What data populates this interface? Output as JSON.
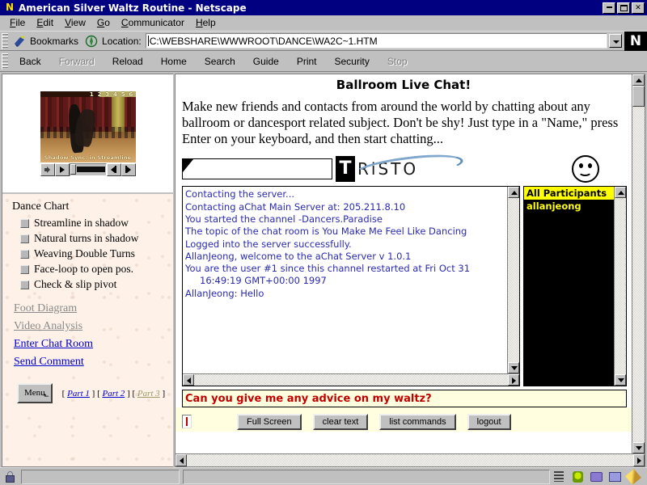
{
  "window": {
    "title": "American Silver Waltz Routine - Netscape",
    "app_icon": "netscape-icon",
    "minimize_label": "Minimize",
    "restore_label": "Restore",
    "close_label": "Close"
  },
  "menubar": {
    "items": [
      {
        "label": "File",
        "accel": "F"
      },
      {
        "label": "Edit",
        "accel": "E"
      },
      {
        "label": "View",
        "accel": "V"
      },
      {
        "label": "Go",
        "accel": "G"
      },
      {
        "label": "Communicator",
        "accel": "C"
      },
      {
        "label": "Help",
        "accel": "H"
      }
    ]
  },
  "location_bar": {
    "bookmarks_label": "Bookmarks",
    "location_label": "Location:",
    "url": "C:\\WEBSHARE\\WWWROOT\\DANCE\\WA2C~1.HTM",
    "placeholder": "Enter URL",
    "dropdown_icon": "chevron-down-icon",
    "bookmark_icon": "bookmark-icon",
    "compass_icon": "compass-icon",
    "brand_letter": "N"
  },
  "navbar": {
    "buttons": [
      {
        "label": "Back",
        "disabled": false
      },
      {
        "label": "Forward",
        "disabled": true
      },
      {
        "label": "Reload",
        "disabled": false
      },
      {
        "label": "Home",
        "disabled": false
      },
      {
        "label": "Search",
        "disabled": false
      },
      {
        "label": "Guide",
        "disabled": false
      },
      {
        "label": "Print",
        "disabled": false
      },
      {
        "label": "Security",
        "disabled": false
      },
      {
        "label": "Stop",
        "disabled": true
      }
    ]
  },
  "sidebar": {
    "video": {
      "counter": "1 2 3 4 5 6",
      "caption": "Shadow Sync. in Streamline",
      "controls": [
        {
          "name": "volume-button",
          "icon": "speaker-icon"
        },
        {
          "name": "play-button",
          "icon": "play-icon"
        },
        {
          "name": "step-back-button",
          "icon": "step-back-icon"
        },
        {
          "name": "step-forward-button",
          "icon": "step-forward-icon"
        }
      ]
    },
    "chart_title": "Dance Chart",
    "chart_items": [
      "Streamline in shadow",
      "Natural turns in shadow",
      "Weaving Double Turns",
      "Face-loop to open pos.",
      "Check & slip pivot"
    ],
    "links": [
      {
        "label": "Foot Diagram",
        "state": "visited"
      },
      {
        "label": "Video Analysis",
        "state": "visited"
      },
      {
        "label": "Enter Chat Room",
        "state": "unvisited"
      },
      {
        "label": "Send Comment",
        "state": "unvisited"
      }
    ],
    "menu_button": "Menu",
    "parts": [
      {
        "label": "Part 1",
        "state": "unvisited"
      },
      {
        "label": "Part 2",
        "state": "unvisited"
      },
      {
        "label": "Part 3",
        "state": "visited"
      }
    ],
    "parts_open": "[ ",
    "parts_sep": " ] [ ",
    "parts_close": " ]"
  },
  "page": {
    "title": "Ballroom Live Chat!",
    "intro": "Make new friends and contacts from around the world by chatting about any ballroom or dancesport related subject. Don't be shy! Just type in a \"Name,\" press Enter on your keyboard, and then start chatting...",
    "logo": {
      "brand_first": "T",
      "brand_rest": "RiSTO",
      "smiley_icon": "smiley-face-icon"
    },
    "name_input_value": "",
    "name_input_placeholder": ""
  },
  "chat": {
    "messages": [
      {
        "text": "Contacting the server...",
        "indent": false
      },
      {
        "text": "Contacting aChat Main Server at: 205.211.8.10",
        "indent": false
      },
      {
        "text": "You started the channel -Dancers.Paradise",
        "indent": false
      },
      {
        "text": "The topic of the chat room is You Make Me Feel Like Dancing",
        "indent": false
      },
      {
        "text": "Logged into the server successfully.",
        "indent": false
      },
      {
        "text": "AllanJeong, welcome to the aChat Server v 1.0.1",
        "indent": false
      },
      {
        "text": "You are the user #1 since this channel restarted at Fri Oct 31",
        "indent": false
      },
      {
        "text": "16:49:19 GMT+00:00 1997",
        "indent": true
      },
      {
        "text": "AllanJeong: Hello",
        "indent": false
      }
    ],
    "participants_header": "All Participants",
    "participants": [
      "allanjeong"
    ],
    "message_input_value": "Can you give me any advice on my waltz?",
    "message_input_placeholder": "Type your message",
    "buttons": [
      "Full Screen",
      "clear text",
      "list commands",
      "logout"
    ]
  },
  "statusbar": {
    "security_icon": "lock-icon",
    "message": "",
    "component_icons": [
      "task-list-icon",
      "navigator-icon",
      "inbox-icon",
      "newsgroup-icon",
      "composer-icon"
    ]
  },
  "colors": {
    "titlebar": "#000080",
    "chrome": "#c0c0c0",
    "chat_text": "#2a2ab0",
    "participant_yellow": "#ffff00",
    "input_red": "#c00000",
    "link_blue": "#0000cc",
    "link_visited": "#8a8a8a",
    "paper": "#fdf1e8"
  }
}
